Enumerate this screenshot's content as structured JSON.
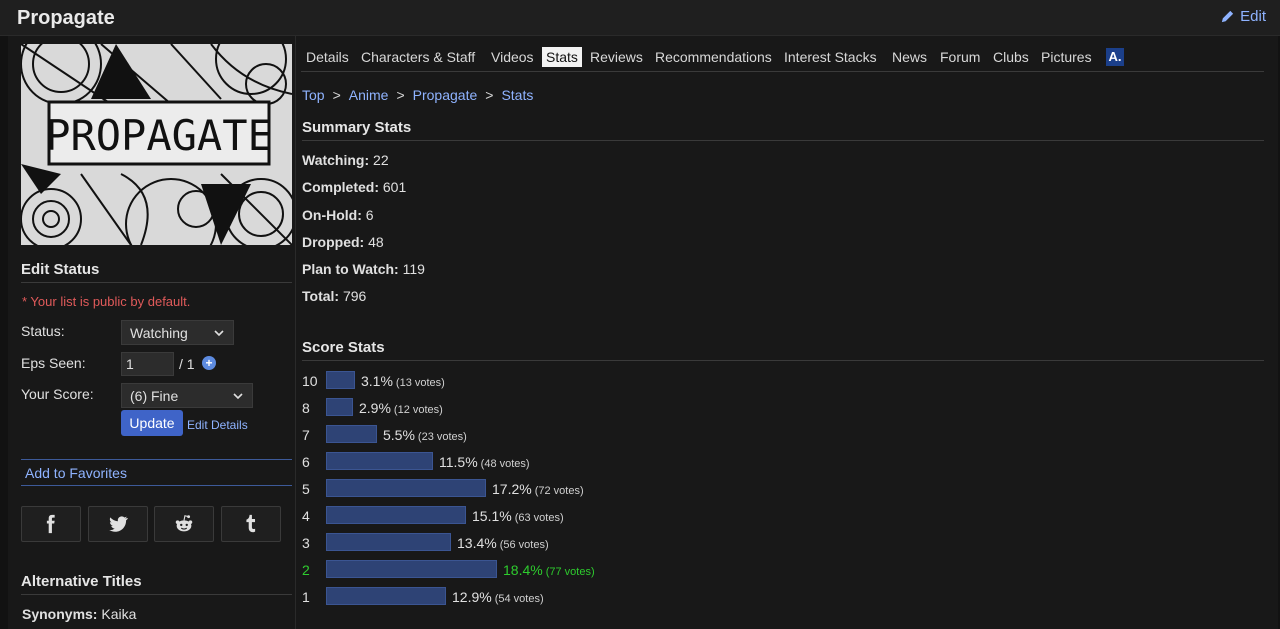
{
  "header": {
    "title": "Propagate",
    "edit_label": "Edit"
  },
  "poster": {
    "text": "PROPAGATE"
  },
  "tabs": [
    {
      "label": "Details"
    },
    {
      "label": "Characters & Staff"
    },
    {
      "label": "Videos"
    },
    {
      "label": "Stats",
      "active": true
    },
    {
      "label": "Reviews"
    },
    {
      "label": "Recommendations"
    },
    {
      "label": "Interest Stacks"
    },
    {
      "label": "News"
    },
    {
      "label": "Forum"
    },
    {
      "label": "Clubs"
    },
    {
      "label": "Pictures"
    }
  ],
  "breadcrumb": {
    "items": [
      "Top",
      "Anime",
      "Propagate",
      "Stats"
    ],
    "separator": ">"
  },
  "edit_status": {
    "title": "Edit Status",
    "public_note": "* Your list is public by default.",
    "status_label": "Status:",
    "status_value": "Watching",
    "eps_label": "Eps Seen:",
    "eps_value": "1",
    "eps_total": "/ 1",
    "score_label": "Your Score:",
    "score_value": "(6) Fine",
    "update_label": "Update",
    "edit_details_label": "Edit Details"
  },
  "favorites": {
    "label": "Add to Favorites"
  },
  "share": {
    "icons": [
      "facebook-icon",
      "twitter-icon",
      "reddit-icon",
      "tumblr-icon"
    ]
  },
  "alt_titles": {
    "title": "Alternative Titles",
    "synonyms_label": "Synonyms:",
    "synonyms_value": "Kaika"
  },
  "summary": {
    "title": "Summary Stats",
    "lines": [
      {
        "label": "Watching:",
        "value": "22"
      },
      {
        "label": "Completed:",
        "value": "601"
      },
      {
        "label": "On-Hold:",
        "value": "6"
      },
      {
        "label": "Dropped:",
        "value": "48"
      },
      {
        "label": "Plan to Watch:",
        "value": "119"
      },
      {
        "label": "Total:",
        "value": "796"
      }
    ]
  },
  "score_stats": {
    "title": "Score Stats",
    "rows": [
      {
        "score": "10",
        "pct": "3.1%",
        "pct_value": 3.1,
        "votes": "(13 votes)"
      },
      {
        "score": "8",
        "pct": "2.9%",
        "pct_value": 2.9,
        "votes": "(12 votes)"
      },
      {
        "score": "7",
        "pct": "5.5%",
        "pct_value": 5.5,
        "votes": "(23 votes)"
      },
      {
        "score": "6",
        "pct": "11.5%",
        "pct_value": 11.5,
        "votes": "(48 votes)"
      },
      {
        "score": "5",
        "pct": "17.2%",
        "pct_value": 17.2,
        "votes": "(72 votes)"
      },
      {
        "score": "4",
        "pct": "15.1%",
        "pct_value": 15.1,
        "votes": "(63 votes)"
      },
      {
        "score": "3",
        "pct": "13.4%",
        "pct_value": 13.4,
        "votes": "(56 votes)"
      },
      {
        "score": "2",
        "pct": "18.4%",
        "pct_value": 18.4,
        "votes": "(77 votes)",
        "highlight": true
      },
      {
        "score": "1",
        "pct": "12.9%",
        "pct_value": 12.9,
        "votes": "(54 votes)"
      }
    ]
  },
  "colors": {
    "accent_link": "#8fb3ff",
    "bar": "#2e4375",
    "highlight": "#2ecc2e",
    "note": "#e05a5a"
  }
}
